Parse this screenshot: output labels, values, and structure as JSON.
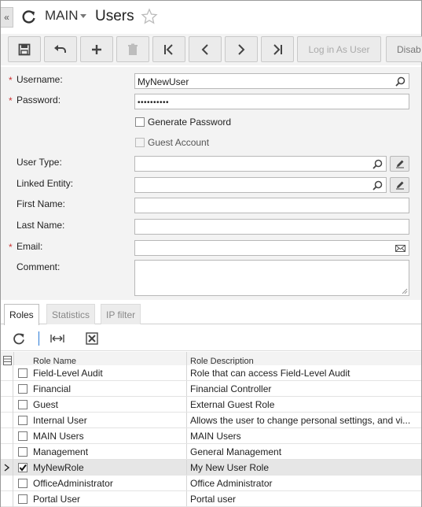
{
  "header": {
    "collapse_glyph": "«",
    "company": "MAIN",
    "title": "Users"
  },
  "toolbar": {
    "log_in_as_user": "Log in As User",
    "disable_label": "Disab"
  },
  "form": {
    "username_label": "Username:",
    "username_value": "MyNewUser",
    "password_label": "Password:",
    "password_value": "••••••••••",
    "generate_password_label": "Generate Password",
    "guest_account_label": "Guest Account",
    "user_type_label": "User Type:",
    "linked_entity_label": "Linked Entity:",
    "first_name_label": "First Name:",
    "last_name_label": "Last Name:",
    "email_label": "Email:",
    "comment_label": "Comment:",
    "required_mark": "*"
  },
  "tabs": [
    "Roles",
    "Statistics",
    "IP filter"
  ],
  "grid": {
    "col_role_name": "Role Name",
    "col_role_description": "Role Description",
    "rows": [
      {
        "name": "Field-Level Audit",
        "desc": "Role that can access Field-Level Audit",
        "checked": false
      },
      {
        "name": "Financial",
        "desc": "Financial Controller",
        "checked": false
      },
      {
        "name": "Guest",
        "desc": "External Guest Role",
        "checked": false
      },
      {
        "name": "Internal User",
        "desc": "Allows the user to change personal settings, and vi...",
        "checked": false
      },
      {
        "name": "MAIN Users",
        "desc": "MAIN Users",
        "checked": false
      },
      {
        "name": "Management",
        "desc": "General Management",
        "checked": false
      },
      {
        "name": "MyNewRole",
        "desc": "My New User Role",
        "checked": true
      },
      {
        "name": "OfficeAdministrator",
        "desc": "Office Administrator",
        "checked": false
      },
      {
        "name": "Portal User",
        "desc": "Portal user",
        "checked": false
      }
    ]
  },
  "icons": {
    "refresh": "refresh-icon",
    "star": "star-icon",
    "save": "save-icon",
    "undo": "undo-icon",
    "add": "plus-icon",
    "delete": "trash-icon",
    "first": "first-page-icon",
    "prev": "chevron-left-icon",
    "next": "chevron-right-icon",
    "last": "last-page-icon",
    "search": "magnifier-icon",
    "edit": "pencil-icon",
    "email": "envelope-icon",
    "fit_columns": "fit-columns-icon",
    "export_excel": "excel-icon",
    "row_pointer": "row-pointer-icon"
  },
  "colors": {
    "accent": "#2a7ad6",
    "required": "#cc3333"
  }
}
